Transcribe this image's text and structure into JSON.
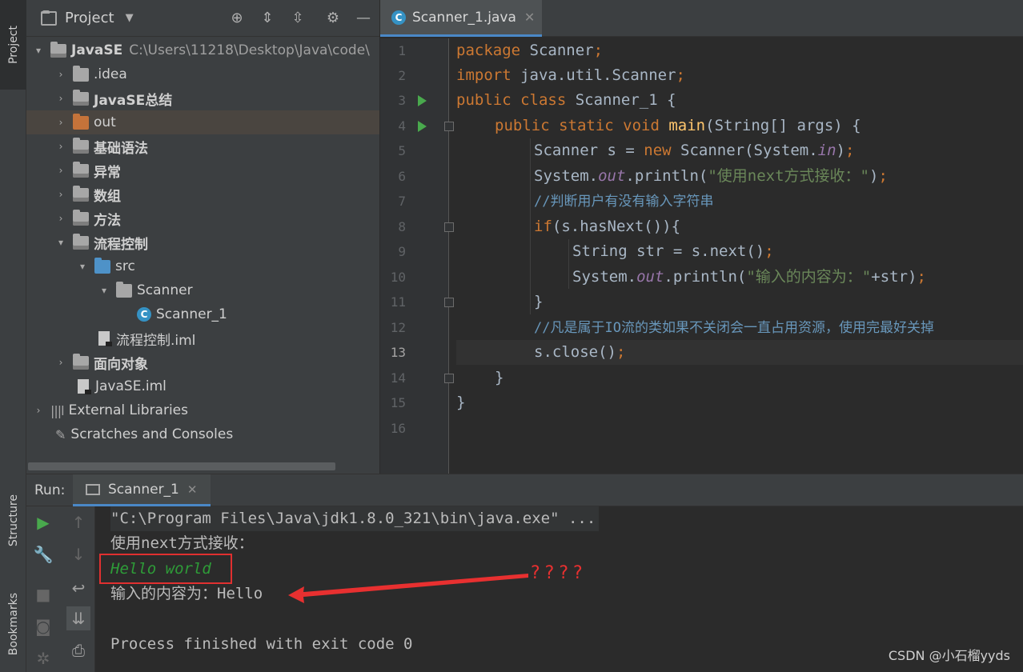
{
  "left_stripe": {
    "project_tab": "Project",
    "structure_tab": "Structure",
    "bookmarks_tab": "Bookmarks"
  },
  "project_panel": {
    "title": "Project",
    "tree": [
      {
        "label": "JavaSE",
        "path": "C:\\Users\\11218\\Desktop\\Java\\code\\",
        "expanded": true
      },
      {
        "label": ".idea"
      },
      {
        "label": "JavaSE总结"
      },
      {
        "label": "out"
      },
      {
        "label": "基础语法"
      },
      {
        "label": "异常"
      },
      {
        "label": "数组"
      },
      {
        "label": "方法"
      },
      {
        "label": "流程控制",
        "expanded": true
      },
      {
        "label": "src",
        "expanded": true
      },
      {
        "label": "Scanner",
        "expanded": true
      },
      {
        "label": "Scanner_1"
      },
      {
        "label": "流程控制.iml"
      },
      {
        "label": "面向对象"
      },
      {
        "label": "JavaSE.iml"
      },
      {
        "label": "External Libraries"
      },
      {
        "label": "Scratches and Consoles"
      }
    ]
  },
  "editor": {
    "tab_label": "Scanner_1.java",
    "tab_icon": "java-class-icon",
    "line_numbers": [
      "1",
      "2",
      "3",
      "4",
      "5",
      "6",
      "7",
      "8",
      "9",
      "10",
      "11",
      "12",
      "13",
      "14",
      "15",
      "16"
    ],
    "current_line": 13,
    "code": {
      "l1_kw": "package",
      "l1_rest": " Scanner",
      "l1_semi": ";",
      "l2_kw": "import",
      "l2_rest": " java.util.Scanner",
      "l2_semi": ";",
      "l3_kw": "public class",
      "l3_rest": " Scanner_1 {",
      "l4_kw": "public static void",
      "l4_fn": "main",
      "l4_rest": "(String[] args) {",
      "l5_a": "Scanner s = ",
      "l5_kw": "new",
      "l5_b": " Scanner(System.",
      "l5_fld": "in",
      "l5_c": ")",
      "l5_semi": ";",
      "l6_a": "System.",
      "l6_fld": "out",
      "l6_b": ".println(",
      "l6_str": "\"使用next方式接收：\"",
      "l6_c": ")",
      "l6_semi": ";",
      "l7_cmt": "//判断用户有没有输入字符串",
      "l8_kw": "if",
      "l8_rest": "(s.hasNext()){",
      "l9_a": "String str = s.next()",
      "l9_semi": ";",
      "l10_a": "System.",
      "l10_fld": "out",
      "l10_b": ".println(",
      "l10_str": "\"输入的内容为：\"",
      "l10_c": "+str)",
      "l10_semi": ";",
      "l11": "}",
      "l12_cmt": "//凡是属于IO流的类如果不关闭会一直占用资源，使用完最好关掉",
      "l13_a": "s.close()",
      "l13_semi": ";",
      "l14": "}",
      "l15": "}"
    }
  },
  "run_panel": {
    "label": "Run:",
    "tab_label": "Scanner_1",
    "console": {
      "cmd": "\"C:\\Program Files\\Java\\jdk1.8.0_321\\bin\\java.exe\" ...",
      "prompt": "使用next方式接收：",
      "user_input": "Hello world",
      "output": "输入的内容为：Hello",
      "exit": "Process finished with exit code 0"
    }
  },
  "annotation": {
    "marks": "????",
    "color": "#e83030"
  },
  "watermark": "CSDN @小石榴yyds"
}
